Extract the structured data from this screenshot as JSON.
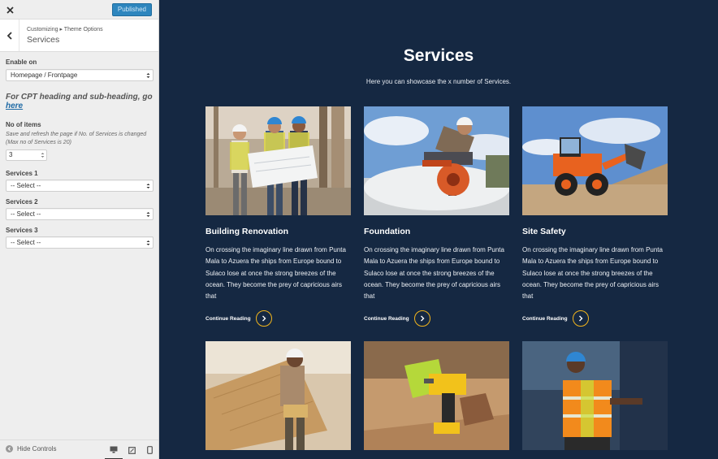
{
  "customizer": {
    "publish_label": "Published",
    "breadcrumb": "Customizing ▸ Theme Options",
    "section_title": "Services",
    "enable_on": {
      "label": "Enable on",
      "value": "Homepage / Frontpage"
    },
    "cpt_note": {
      "text": "For CPT heading and sub-heading, go ",
      "link": "here"
    },
    "items": {
      "label": "No of items",
      "description": "Save and refresh the page if No. of Services is changed (Max no of Services is 20)",
      "value": "3"
    },
    "services": [
      {
        "label": "Services 1",
        "value": "-- Select --"
      },
      {
        "label": "Services 2",
        "value": "-- Select --"
      },
      {
        "label": "Services 3",
        "value": "-- Select --"
      }
    ],
    "hide_controls": "Hide Controls",
    "devices": [
      "desktop-icon",
      "tablet-icon",
      "mobile-icon"
    ]
  },
  "preview": {
    "title": "Services",
    "subtitle": "Here you can showcase the x number of Services.",
    "continue_label": "Continue Reading",
    "accent_color": "#f2b51c",
    "background_color": "#152842",
    "cards": [
      {
        "title": "Building Renovation",
        "text": "On crossing the imaginary line drawn from Punta Mala to Azuera the ships from Europe bound to Sulaco lose at once the strong breezes of the ocean. They become the prey of capricious airs that"
      },
      {
        "title": "Foundation",
        "text": "On crossing the imaginary line drawn from Punta Mala to Azuera the ships from Europe bound to Sulaco lose at once the strong breezes of the ocean. They become the prey of capricious airs that"
      },
      {
        "title": "Site Safety",
        "text": "On crossing the imaginary line drawn from Punta Mala to Azuera the ships from Europe bound to Sulaco lose at once the strong breezes of the ocean. They become the prey of capricious airs that"
      }
    ]
  }
}
